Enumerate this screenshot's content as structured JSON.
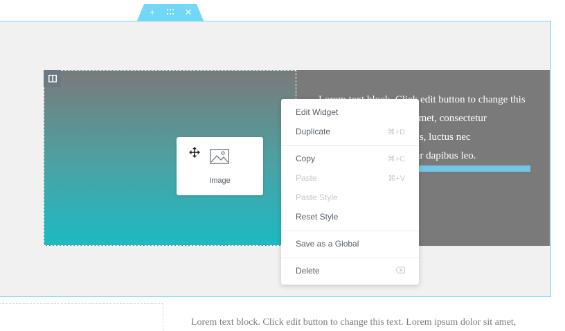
{
  "section_handle": {
    "add_icon": "plus-icon",
    "drag_icon": "drag-grid-icon",
    "close_icon": "close-icon",
    "accent_color": "#71d7f7"
  },
  "column_handle_icon": "column-layout-icon",
  "text_block": {
    "lines": [
      "Lorem text block. Click edit button to change this",
      "sit amet, consectetur",
      "llus, luctus nec",
      "inar dapibus leo."
    ]
  },
  "image_widget": {
    "icon": "image-icon",
    "label": "Image"
  },
  "cursor_icon": "move-cursor-icon",
  "context_menu": {
    "edit_widget": "Edit Widget",
    "duplicate": "Duplicate",
    "duplicate_key": "⌘+D",
    "copy": "Copy",
    "copy_key": "⌘+C",
    "paste": "Paste",
    "paste_key": "⌘+V",
    "paste_style": "Paste Style",
    "reset_style": "Reset Style",
    "save_global": "Save as a Global",
    "delete": "Delete",
    "delete_icon": "backspace-icon"
  },
  "bottom_text": "Lorem text block. Click edit button to change this text. Lorem ipsum dolor sit amet,"
}
